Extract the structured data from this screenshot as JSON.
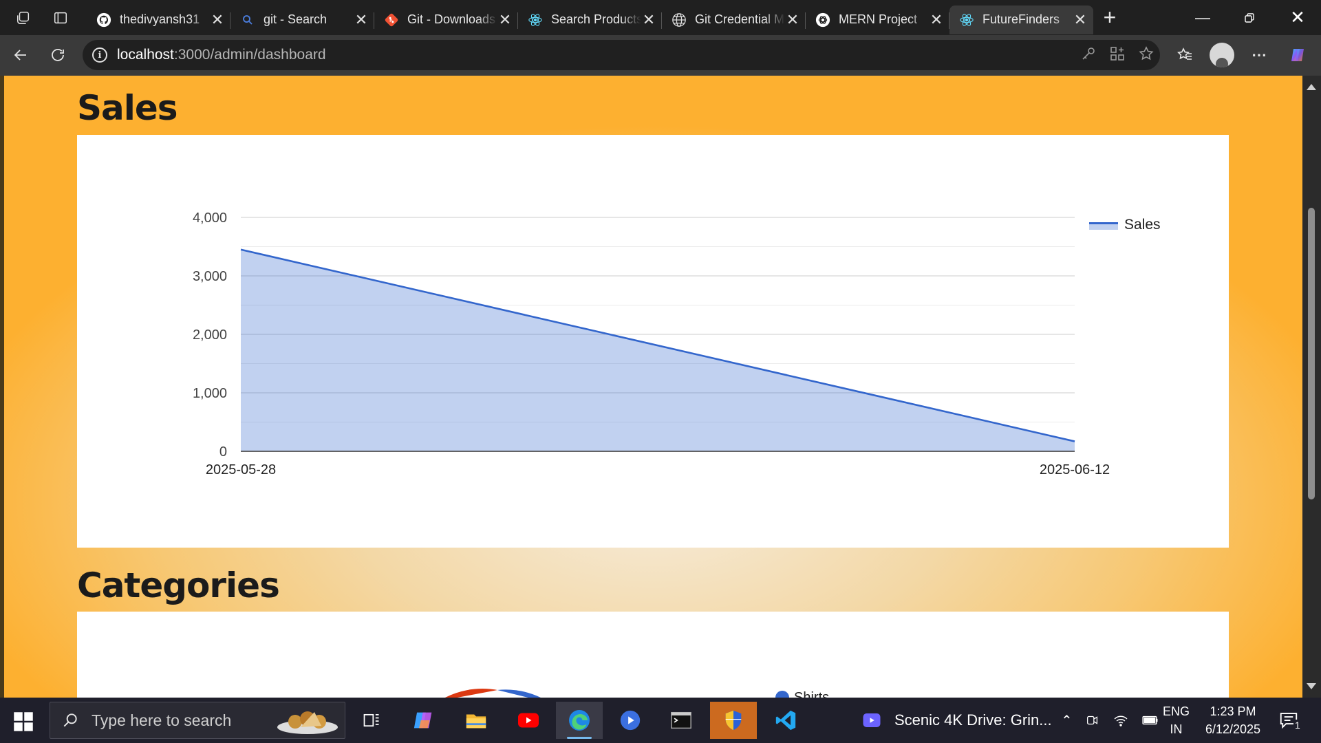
{
  "browser": {
    "tabs": [
      {
        "title": "thedivyansh31",
        "favicon": "github-icon",
        "color": "#ffffff"
      },
      {
        "title": "git - Search",
        "favicon": "search-icon",
        "color": "#4a7cdb"
      },
      {
        "title": "Git - Downloads",
        "favicon": "git-icon",
        "color": "#f05133"
      },
      {
        "title": "Search Products",
        "favicon": "react-icon",
        "color": "#61dafb"
      },
      {
        "title": "Git Credential Manager",
        "favicon": "globe-icon",
        "color": "#e0e0e0"
      },
      {
        "title": "MERN Project",
        "favicon": "openai-icon",
        "color": "#ffffff"
      },
      {
        "title": "FutureFinders",
        "favicon": "react-icon",
        "color": "#61dafb"
      }
    ],
    "active_tab": 6,
    "url": {
      "host": "localhost",
      "path": ":3000/admin/dashboard"
    }
  },
  "page": {
    "sales_title": "Sales",
    "categories_title": "Categories",
    "categories_legend": [
      {
        "name": "Shirts",
        "color": "#3366cc"
      }
    ]
  },
  "chart_data": {
    "type": "area",
    "title": "",
    "x": [
      "2025-05-28",
      "2025-06-12"
    ],
    "series": [
      {
        "name": "Sales",
        "values": [
          3450,
          170
        ],
        "color": "#3366cc"
      }
    ],
    "ylim": [
      0,
      4000
    ],
    "yticks": [
      0,
      1000,
      2000,
      3000,
      4000
    ],
    "ytick_labels": [
      "0",
      "1,000",
      "2,000",
      "3,000",
      "4,000"
    ],
    "xtick_labels": [
      "2025-05-28",
      "2025-06-12"
    ],
    "grid": true,
    "legend": "right"
  },
  "taskbar": {
    "search_placeholder": "Type here to search",
    "media_title": "Scenic 4K Drive: Grin...",
    "language": "ENG",
    "region": "IN",
    "time": "1:23 PM",
    "date": "6/12/2025",
    "notification_count": "1"
  }
}
